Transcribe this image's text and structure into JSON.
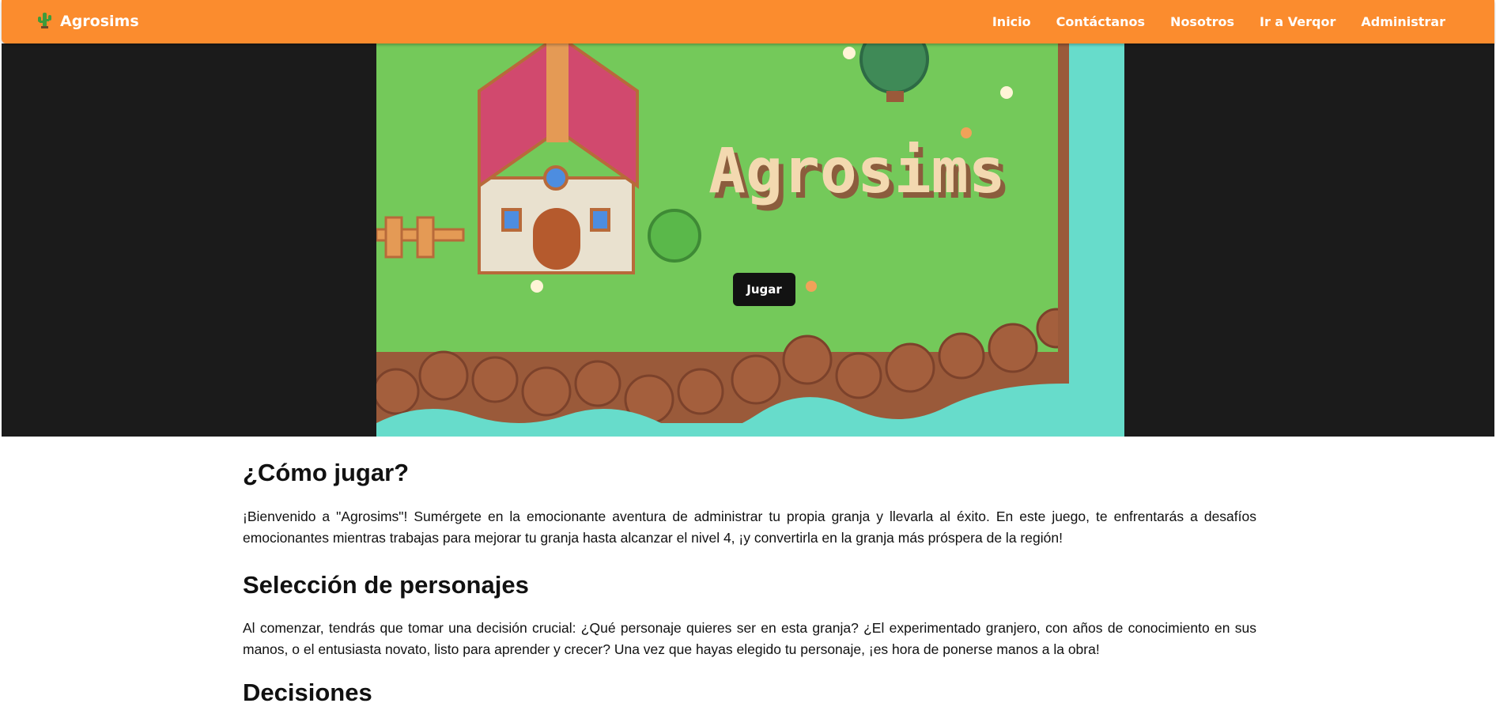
{
  "navbar": {
    "brand": "Agrosims",
    "brand_icon": "cactus-icon",
    "links": [
      "Inicio",
      "Contáctanos",
      "Nosotros",
      "Ir a Verqor",
      "Administrar"
    ],
    "color": "#fb8c2e"
  },
  "hero": {
    "title": "Agrosims",
    "play_button": "Jugar"
  },
  "content": {
    "how_to_title": "¿Cómo jugar?",
    "how_to_text": "¡Bienvenido a \"Agrosims\"! Sumérgete en la emocionante aventura de administrar tu propia granja y llevarla al éxito. En este juego, te enfrentarás a desafíos emocionantes mientras trabajas para mejorar tu granja hasta alcanzar el nivel 4, ¡y convertirla en la granja más próspera de la región!",
    "characters_title": "Selección de personajes",
    "characters_text": "Al comenzar, tendrás que tomar una decisión crucial: ¿Qué personaje quieres ser en esta granja? ¿El experimentado granjero, con años de conocimiento en sus manos, o el entusiasta novato, listo para aprender y crecer? Una vez que hayas elegido tu personaje, ¡es hora de ponerse manos a la obra!",
    "decisions_title": "Decisiones"
  }
}
